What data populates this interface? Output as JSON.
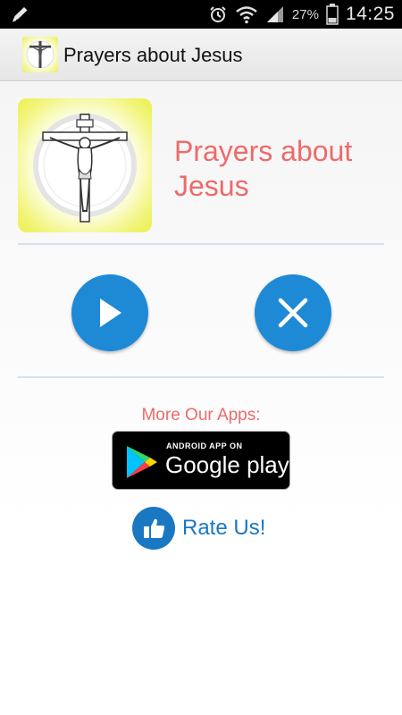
{
  "status_bar": {
    "battery_percent": "27%",
    "clock": "14:25",
    "icons": [
      "edit-icon",
      "alarm-icon",
      "wifi-icon",
      "signal-icon",
      "battery-icon"
    ]
  },
  "action_bar": {
    "title": "Prayers about Jesus",
    "app_icon": "crucifix-icon"
  },
  "hero": {
    "title": "Prayers about Jesus",
    "icon": "crucifix-icon"
  },
  "actions": {
    "play_icon": "play-icon",
    "close_icon": "close-icon"
  },
  "more_apps": {
    "label": "More Our Apps:",
    "badge_small": "ANDROID APP ON",
    "badge_big": "Google play"
  },
  "rate": {
    "label": "Rate Us!",
    "icon": "thumbs-up-icon"
  },
  "colors": {
    "accent_red": "#ee6a6a",
    "button_blue": "#1e8ad6",
    "rate_blue": "#1a78c2",
    "divider": "#cfe3f7"
  }
}
